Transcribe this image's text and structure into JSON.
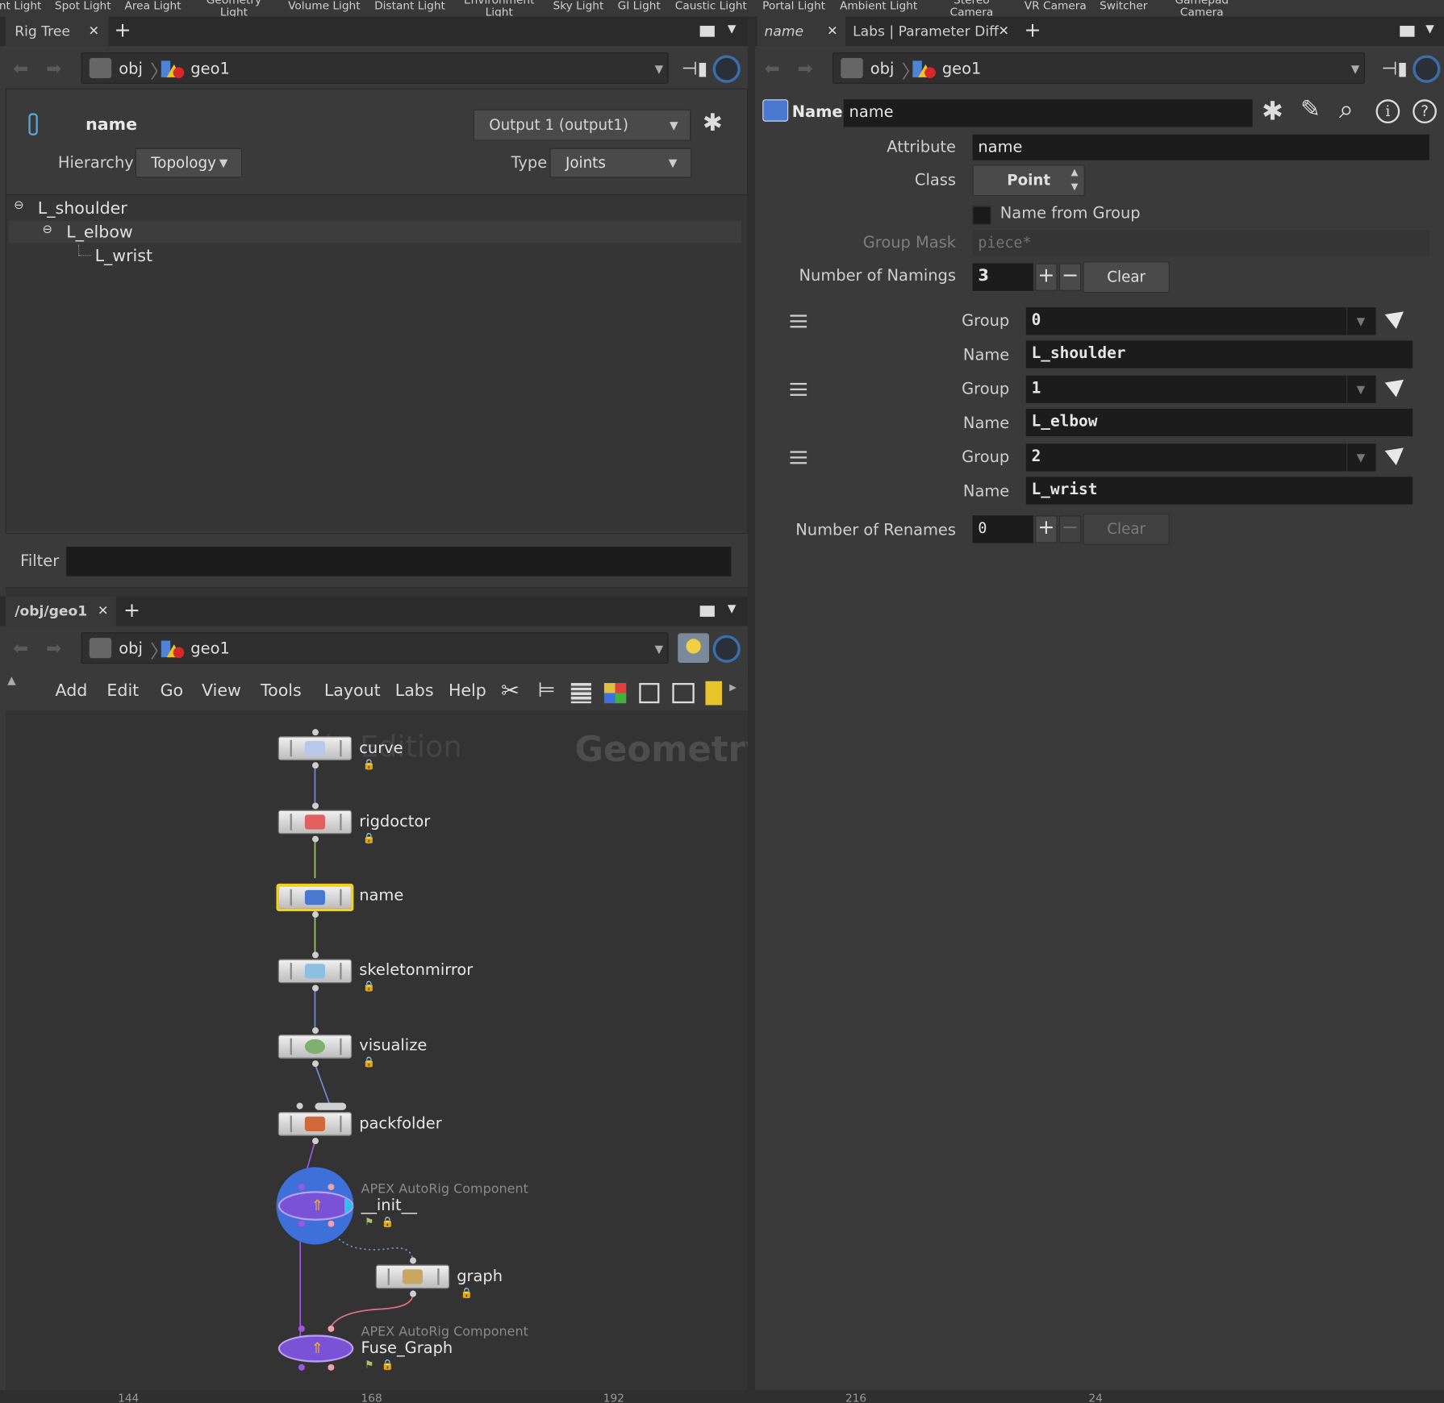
{
  "shelf": {
    "items": [
      "nt Light",
      "Spot Light",
      "Area Light",
      "Geometry Light",
      "Volume Light",
      "Distant Light",
      "Environment Light",
      "Sky Light",
      "GI Light",
      "Caustic Light",
      "Portal Light",
      "Ambient Light",
      "Stereo Camera",
      "VR Camera",
      "Switcher",
      "Gamepad Camera"
    ]
  },
  "left_top": {
    "tab_label": "Rig Tree",
    "path_obj": "obj",
    "path_geo": "geo1",
    "node_name": "name",
    "output_select": "Output 1 (output1)",
    "hierarchy_label": "Hierarchy",
    "hierarchy_value": "Topology",
    "type_label": "Type",
    "type_value": "Joints",
    "tree": [
      "L_shoulder",
      "L_elbow",
      "L_wrist"
    ],
    "filter_label": "Filter",
    "filter_value": ""
  },
  "left_bottom": {
    "tab_label": "/obj/geo1",
    "path_obj": "obj",
    "path_geo": "geo1",
    "menu": [
      "Add",
      "Edit",
      "Go",
      "View",
      "Tools",
      "Layout",
      "Labs",
      "Help"
    ],
    "watermark": "Geometry",
    "watermark2": "le Edition",
    "nodes": {
      "curve": "curve",
      "rigdoctor": "rigdoctor",
      "name": "name",
      "skeletonmirror": "skeletonmirror",
      "visualize": "visualize",
      "packfolder": "packfolder",
      "init_type": "APEX AutoRig Component",
      "init": "__init__",
      "graph": "graph",
      "fuse_type": "APEX AutoRig Component",
      "fuse": "Fuse_Graph"
    },
    "ruler": [
      "144",
      "168",
      "192",
      "216",
      "24"
    ]
  },
  "right": {
    "tab1_label": "name",
    "tab2_label": "Labs | Parameter Diff",
    "path_obj": "obj",
    "path_geo": "geo1",
    "node_type": "Name",
    "node_name": "name",
    "attribute_label": "Attribute",
    "attribute_value": "name",
    "class_label": "Class",
    "class_value": "Point",
    "name_from_group_label": "Name from Group",
    "group_mask_label": "Group Mask",
    "group_mask_placeholder": "piece*",
    "num_namings_label": "Number of Namings",
    "num_namings_value": "3",
    "clear_label": "Clear",
    "namings": [
      {
        "group_label": "Group",
        "group": "0",
        "name_label": "Name",
        "name": "L_shoulder"
      },
      {
        "group_label": "Group",
        "group": "1",
        "name_label": "Name",
        "name": "L_elbow"
      },
      {
        "group_label": "Group",
        "group": "2",
        "name_label": "Name",
        "name": "L_wrist"
      }
    ],
    "num_renames_label": "Number of Renames",
    "num_renames_value": "0",
    "clear2_label": "Clear"
  },
  "colors": {
    "selected_node_border": "#f2d21b",
    "apex_purple": "#7a52d6",
    "apex_blue": "#3f6fd8"
  }
}
